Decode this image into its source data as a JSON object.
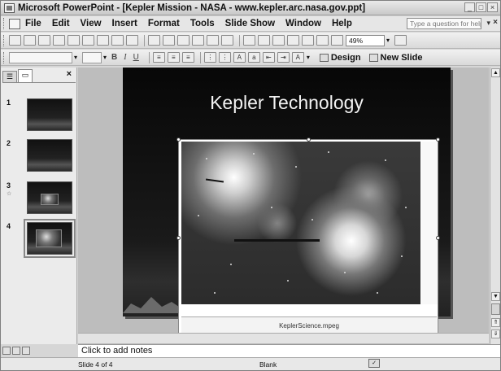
{
  "window": {
    "title": "Microsoft PowerPoint - [Kepler Mission - NASA - www.kepler.arc.nasa.gov.ppt]",
    "buttons": [
      "_",
      "□",
      "×"
    ]
  },
  "menubar": {
    "items": [
      "File",
      "Edit",
      "View",
      "Insert",
      "Format",
      "Tools",
      "Slide Show",
      "Window",
      "Help"
    ],
    "help_placeholder": "Type a question for help"
  },
  "toolbar": {
    "zoom": "49%",
    "design_label": "Design",
    "new_slide_label": "New Slide"
  },
  "slides_pane": {
    "thumbnails": [
      {
        "number": "1",
        "sub": ""
      },
      {
        "number": "2",
        "sub": ""
      },
      {
        "number": "3",
        "sub": "☆"
      },
      {
        "number": "4",
        "sub": ""
      }
    ],
    "selected": 4
  },
  "slide": {
    "title": "Kepler Technology",
    "movie_caption": "KeplerScience.mpeg"
  },
  "notes": {
    "placeholder": "Click to add notes"
  },
  "status": {
    "slide": "Slide 4 of 4",
    "design": "Blank"
  }
}
